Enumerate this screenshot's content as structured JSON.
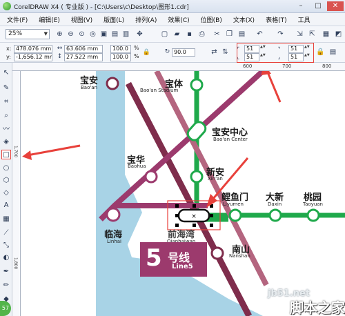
{
  "window": {
    "title": "CorelDRAW X4 ( 专业版 ) - [C:\\Users\\c\\Desktop\\图形1.cdr]",
    "minimize": "–",
    "maximize": "□",
    "close": "✕"
  },
  "menu": {
    "items": [
      "文件(F)",
      "编辑(E)",
      "视图(V)",
      "版面(L)",
      "排列(A)",
      "效果(C)",
      "位图(B)",
      "文本(X)",
      "表格(T)",
      "工具"
    ]
  },
  "toolbar": {
    "zoom_value": "25%"
  },
  "propbar": {
    "x_label": "x:",
    "y_label": "y:",
    "x_value": "478.076 mm",
    "y_value": "-1,656.12 mm",
    "w_value": "63.606 mm",
    "h_value": "27.522 mm",
    "scale_w": "100.0",
    "scale_h": "100.0",
    "percent": "%",
    "angle": "90.0",
    "corner_tl": "51",
    "corner_bl": "51",
    "corner_tr": "51",
    "corner_br": "51"
  },
  "ruler": {
    "top_ticks": [
      "600",
      "700",
      "800"
    ],
    "left_ticks": [
      "1,700",
      "1,800"
    ]
  },
  "stations": [
    {
      "cn": "宝安",
      "en": "Bao'an"
    },
    {
      "cn": "宝体",
      "en": "Bao'an Stadium"
    },
    {
      "cn": "宝安中心",
      "en": "Bao'an Center"
    },
    {
      "cn": "宝华",
      "en": "Baohua"
    },
    {
      "cn": "新安",
      "en": "Xin'an"
    },
    {
      "cn": "鲤鱼门",
      "en": "Liyumen"
    },
    {
      "cn": "大新",
      "en": "Daxin"
    },
    {
      "cn": "桃园",
      "en": "Taoyuan"
    },
    {
      "cn": "临海",
      "en": "Linhai"
    },
    {
      "cn": "前海湾",
      "en": "Qianhaiwan"
    },
    {
      "cn": "南山",
      "en": "Nanshan"
    }
  ],
  "line_badge": {
    "number": "5",
    "name": "号线",
    "en": "Line5"
  },
  "watermark": {
    "site": "jb51.net",
    "name": "脚本之家"
  },
  "colors": {
    "line1_green": "#1fa94b",
    "line5_purple": "#9c3a6d",
    "line11_maroon": "#7f2d4c",
    "line_mauve": "#b4657f",
    "water": "#a8d3e6",
    "annotation_red": "#e8413b"
  }
}
